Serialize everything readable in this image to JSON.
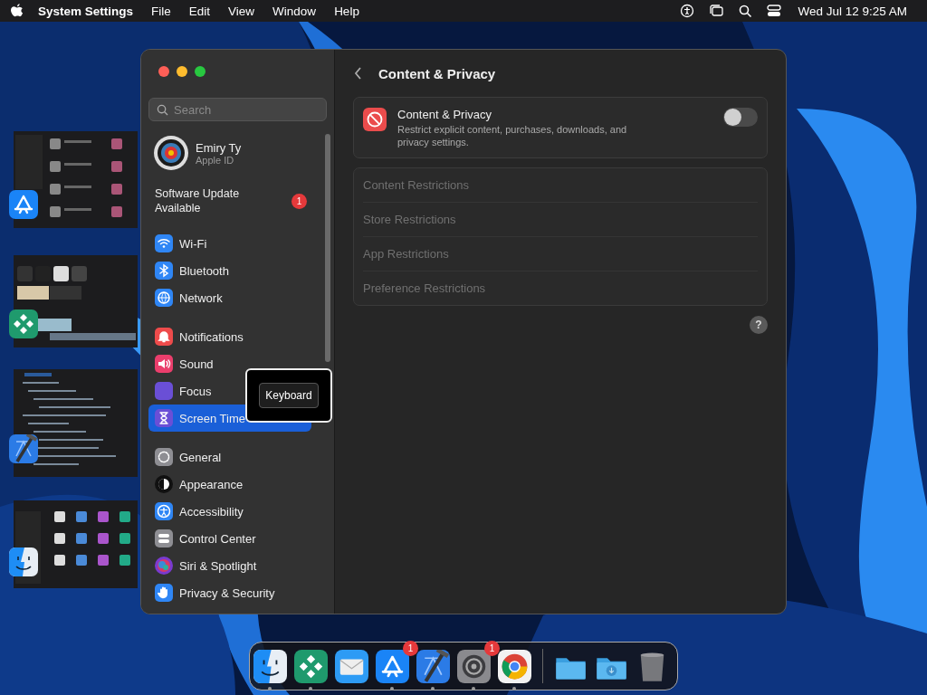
{
  "menubar": {
    "app_name": "System Settings",
    "menus": [
      "File",
      "Edit",
      "View",
      "Window",
      "Help"
    ],
    "clock": "Wed Jul 12  9:25 AM"
  },
  "stage_windows": [
    {
      "kind": "appstore"
    },
    {
      "kind": "diamond"
    },
    {
      "kind": "xcode"
    },
    {
      "kind": "finder"
    }
  ],
  "settings": {
    "search": {
      "placeholder": "Search"
    },
    "account": {
      "name": "Emiry Ty",
      "subtitle": "Apple ID"
    },
    "update": {
      "label": "Software Update Available",
      "badge": "1"
    },
    "sidebar_groups": [
      [
        {
          "label": "Wi-Fi",
          "kind": "wifi",
          "selected": false
        },
        {
          "label": "Bluetooth",
          "kind": "bluetooth",
          "selected": false
        },
        {
          "label": "Network",
          "kind": "network",
          "selected": false
        }
      ],
      [
        {
          "label": "Notifications",
          "kind": "notifications",
          "selected": false
        },
        {
          "label": "Sound",
          "kind": "sound",
          "selected": false
        },
        {
          "label": "Focus",
          "kind": "focus",
          "selected": false
        },
        {
          "label": "Screen Time",
          "kind": "screentime",
          "selected": true
        }
      ],
      [
        {
          "label": "General",
          "kind": "general",
          "selected": false
        },
        {
          "label": "Appearance",
          "kind": "appearance",
          "selected": false
        },
        {
          "label": "Accessibility",
          "kind": "accessibility",
          "selected": false
        },
        {
          "label": "Control Center",
          "kind": "controlcenter",
          "selected": false
        },
        {
          "label": "Siri & Spotlight",
          "kind": "siri",
          "selected": false
        },
        {
          "label": "Privacy & Security",
          "kind": "privacy",
          "selected": false
        }
      ]
    ],
    "detail": {
      "title": "Content & Privacy",
      "card": {
        "title": "Content & Privacy",
        "description": "Restrict explicit content, purchases, downloads, and privacy settings.",
        "on": false
      },
      "restrictions": [
        {
          "label": "Content Restrictions",
          "disabled": true
        },
        {
          "label": "Store Restrictions",
          "disabled": true
        },
        {
          "label": "App Restrictions",
          "disabled": true
        },
        {
          "label": "Preference Restrictions",
          "disabled": true
        }
      ],
      "help": "?"
    }
  },
  "tooltip": {
    "label": "Keyboard"
  },
  "dock": [
    {
      "kind": "finder",
      "running": true
    },
    {
      "kind": "diamond",
      "running": true
    },
    {
      "kind": "mail",
      "running": false
    },
    {
      "kind": "appstore",
      "running": true,
      "badge": "1"
    },
    {
      "kind": "xcode",
      "running": true
    },
    {
      "kind": "settings",
      "running": true,
      "badge": "1"
    },
    {
      "kind": "chrome",
      "running": true
    },
    {
      "kind": "separator"
    },
    {
      "kind": "folder",
      "running": false
    },
    {
      "kind": "downloads",
      "running": false
    },
    {
      "kind": "trash",
      "running": false
    }
  ]
}
